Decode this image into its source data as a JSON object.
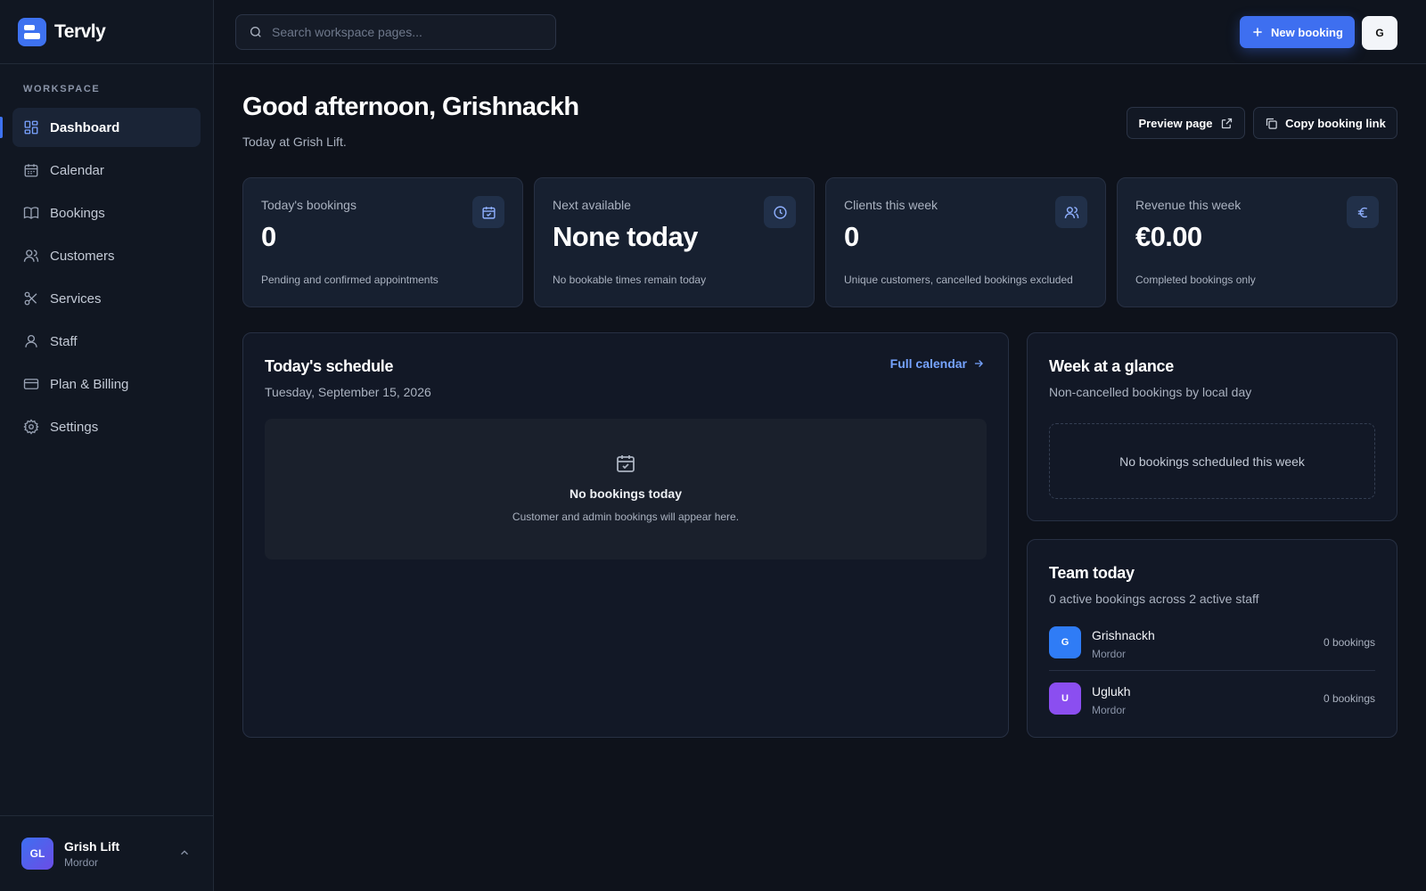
{
  "brand": {
    "name": "Tervly"
  },
  "search": {
    "placeholder": "Search workspace pages..."
  },
  "topbar": {
    "new_booking_label": "New booking",
    "user_initial": "G"
  },
  "sidebar": {
    "section_label": "WORKSPACE",
    "items": [
      {
        "label": "Dashboard",
        "icon": "dashboard-icon",
        "active": true
      },
      {
        "label": "Calendar",
        "icon": "calendar-icon"
      },
      {
        "label": "Bookings",
        "icon": "book-icon"
      },
      {
        "label": "Customers",
        "icon": "users-icon"
      },
      {
        "label": "Services",
        "icon": "scissors-icon"
      },
      {
        "label": "Staff",
        "icon": "user-icon"
      },
      {
        "label": "Plan & Billing",
        "icon": "credit-card-icon"
      },
      {
        "label": "Settings",
        "icon": "gear-icon"
      }
    ],
    "account": {
      "initials": "GL",
      "name": "Grish Lift",
      "subtitle": "Mordor"
    }
  },
  "header": {
    "greeting": "Good afternoon, Grishnackh",
    "subtitle": "Today at Grish Lift.",
    "preview_label": "Preview page",
    "copy_label": "Copy booking link"
  },
  "stats": [
    {
      "label": "Today's bookings",
      "value": "0",
      "note": "Pending and confirmed appointments",
      "icon": "calendar-check-icon"
    },
    {
      "label": "Next available",
      "value": "None today",
      "note": "No bookable times remain today",
      "icon": "clock-icon"
    },
    {
      "label": "Clients this week",
      "value": "0",
      "note": "Unique customers, cancelled bookings excluded",
      "icon": "users-icon"
    },
    {
      "label": "Revenue this week",
      "value": "€0.00",
      "note": "Completed bookings only",
      "icon": "euro-icon"
    }
  ],
  "schedule": {
    "title": "Today's schedule",
    "date": "Tuesday, September 15, 2026",
    "full_calendar_label": "Full calendar",
    "empty_title": "No bookings today",
    "empty_sub": "Customer and admin bookings will appear here."
  },
  "week": {
    "title": "Week at a glance",
    "subtitle": "Non-cancelled bookings by local day",
    "empty": "No bookings scheduled this week"
  },
  "team": {
    "title": "Team today",
    "subtitle": "0 active bookings across 2 active staff",
    "members": [
      {
        "initial": "G",
        "name": "Grishnackh",
        "location": "Mordor",
        "count": "0 bookings",
        "color": "#2f7cf6"
      },
      {
        "initial": "U",
        "name": "Uglukh",
        "location": "Mordor",
        "count": "0 bookings",
        "color": "#8b4ef0"
      }
    ]
  },
  "colors": {
    "accent": "#3e6ff0",
    "background": "#0e121b",
    "link": "#76a3ff"
  }
}
